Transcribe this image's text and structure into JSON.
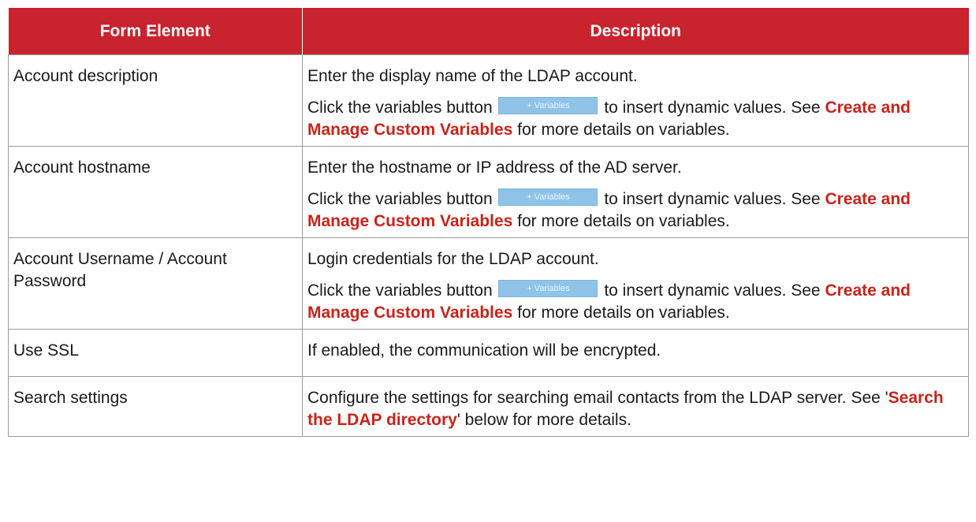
{
  "table": {
    "headers": [
      "Form Element",
      "Description"
    ],
    "variables_button_label": "+ Variables",
    "rows": [
      {
        "element": "Account description",
        "line1": "Enter the display name of the LDAP account.",
        "line2_pre": "Click the variables button",
        "line2_mid": "to insert dynamic values. See",
        "link": "Create and Manage Custom Variables",
        "line2_post": "for more details on variables."
      },
      {
        "element": "Account hostname",
        "line1": "Enter the hostname or IP address of the AD server.",
        "line2_pre": "Click the variables button",
        "line2_mid": "to insert dynamic values. See",
        "link": "Create and Manage Custom Variables",
        "line2_post": "for more details on variables."
      },
      {
        "element": "Account Username / Account Password",
        "line1": "Login credentials for the LDAP account.",
        "line2_pre": "Click the variables button",
        "line2_mid": "to insert dynamic values. See",
        "link": "Create and Manage Custom Variables",
        "line2_post": "for more details on variables."
      },
      {
        "element": "Use SSL",
        "line1": "If enabled, the communication will be encrypted."
      },
      {
        "element": "Search settings",
        "line1_pre": "Configure the settings for searching email contacts from the LDAP server. See '",
        "link": "Search the LDAP directory",
        "line1_post": "' below for more details."
      }
    ]
  }
}
